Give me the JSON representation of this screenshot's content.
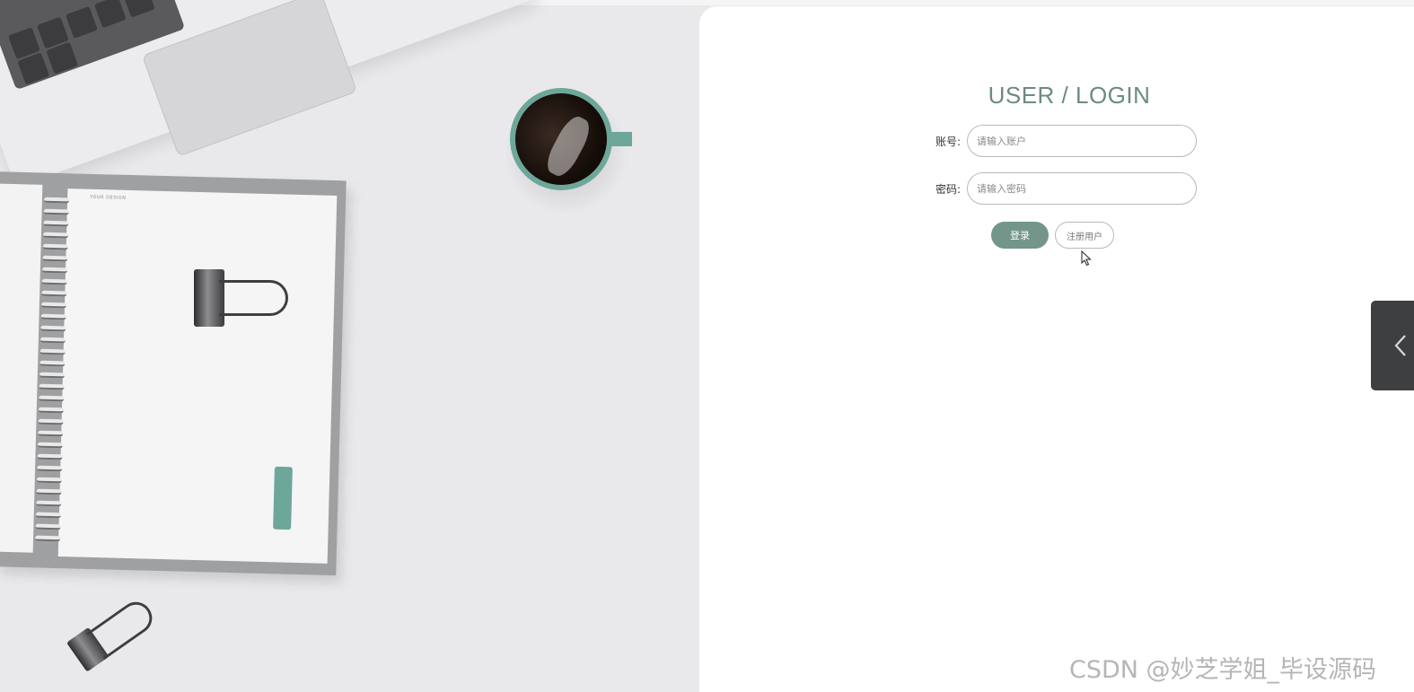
{
  "login": {
    "title": "USER / LOGIN",
    "account_label": "账号:",
    "account_placeholder": "请输入账户",
    "account_value": "",
    "password_label": "密码:",
    "password_placeholder": "请输入密码",
    "password_value": "",
    "login_button": "登录",
    "register_button": "注册用户"
  },
  "side_toggle": {
    "icon": "chevron-left-icon"
  },
  "watermark": "CSDN @妙芝学姐_毕设源码",
  "colors": {
    "accent": "#73958a",
    "title": "#6e8a81",
    "panel_bg": "#ffffff",
    "side_toggle_bg": "#3d3f41",
    "cup": "#6da79a"
  }
}
